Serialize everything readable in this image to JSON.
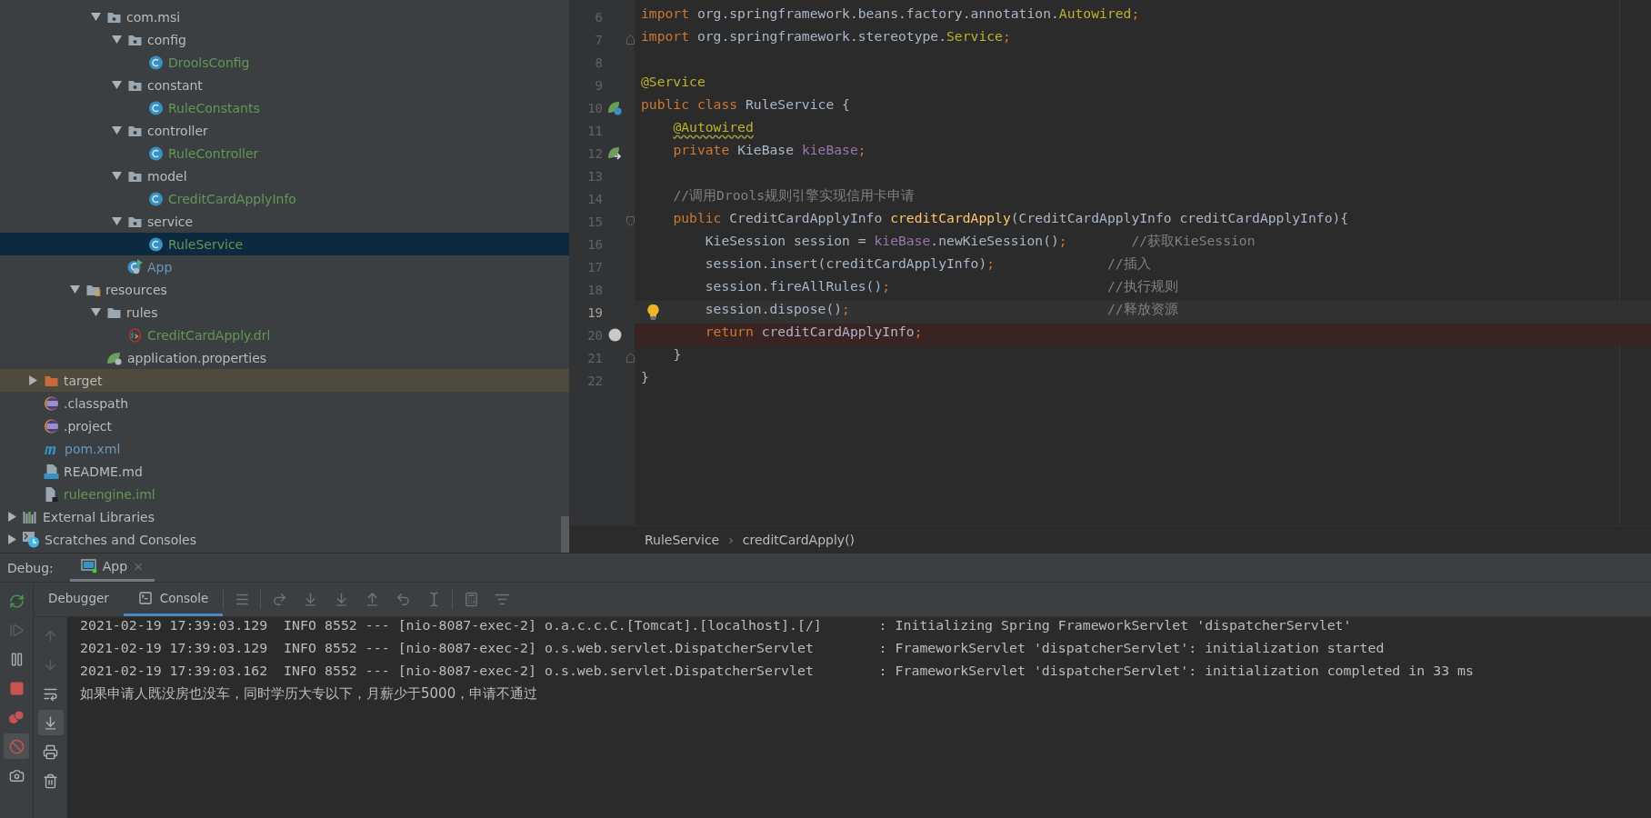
{
  "tree": {
    "packages": [
      {
        "label": "com.msi",
        "kind": "package",
        "color": "#bbbbbb",
        "expanded": true,
        "selected": false,
        "children": [
          {
            "label": "config",
            "kind": "package",
            "color": "#bbbbbb",
            "expanded": true,
            "selected": false,
            "children": [
              {
                "label": "DroolsConfig",
                "kind": "class",
                "color": "#629755",
                "selected": false
              }
            ]
          },
          {
            "label": "constant",
            "kind": "package",
            "color": "#bbbbbb",
            "expanded": true,
            "selected": false,
            "children": [
              {
                "label": "RuleConstants",
                "kind": "class",
                "color": "#629755",
                "selected": false
              }
            ]
          },
          {
            "label": "controller",
            "kind": "package",
            "color": "#bbbbbb",
            "expanded": true,
            "selected": false,
            "children": [
              {
                "label": "RuleController",
                "kind": "class",
                "color": "#629755",
                "selected": false
              }
            ]
          },
          {
            "label": "model",
            "kind": "package",
            "color": "#bbbbbb",
            "expanded": true,
            "selected": false,
            "children": [
              {
                "label": "CreditCardApplyInfo",
                "kind": "class",
                "color": "#629755",
                "selected": false
              }
            ]
          },
          {
            "label": "service",
            "kind": "package",
            "color": "#bbbbbb",
            "expanded": true,
            "selected": false,
            "children": [
              {
                "label": "RuleService",
                "kind": "class",
                "color": "#629755",
                "selected": true
              }
            ]
          },
          {
            "label": "App",
            "kind": "app",
            "color": "#6897bb",
            "selected": false
          }
        ]
      }
    ],
    "main_folders": [
      {
        "label": "resources",
        "kind": "resources",
        "color": "#bbbbbb",
        "expanded": true,
        "selected": false,
        "children": [
          {
            "label": "rules",
            "kind": "folder",
            "color": "#bbbbbb",
            "expanded": true,
            "selected": false,
            "children": [
              {
                "label": "CreditCardApply.drl",
                "kind": "drl",
                "color": "#629755",
                "selected": false
              }
            ]
          },
          {
            "label": "application.properties",
            "kind": "properties",
            "color": "#bbbbbb",
            "selected": false
          }
        ]
      }
    ],
    "module_files": [
      {
        "label": "target",
        "kind": "excluded-folder",
        "color": "#bbbbbb",
        "expanded": false,
        "selected": false
      },
      {
        "label": ".classpath",
        "kind": "eclipse",
        "color": "#bbbbbb",
        "selected": false
      },
      {
        "label": ".project",
        "kind": "eclipse",
        "color": "#bbbbbb",
        "selected": false
      },
      {
        "label": "pom.xml",
        "kind": "maven",
        "color": "#6897bb",
        "selected": false
      },
      {
        "label": "README.md",
        "kind": "markdown",
        "color": "#bbbbbb",
        "selected": false
      },
      {
        "label": "ruleengine.iml",
        "kind": "iml",
        "color": "#629755",
        "selected": false
      }
    ],
    "roots": [
      {
        "label": "External Libraries",
        "kind": "libraries",
        "color": "#bbbbbb",
        "expanded": false,
        "selected": false
      },
      {
        "label": "Scratches and Consoles",
        "kind": "scratches",
        "color": "#bbbbbb",
        "expanded": false,
        "selected": false
      }
    ]
  },
  "editor": {
    "lines": [
      {
        "number": "6",
        "current": false,
        "tokens": [
          {
            "kind": "kw",
            "text": "import "
          },
          {
            "kind": "plain",
            "text": "org.springframework.beans.factory.annotation."
          },
          {
            "kind": "ann",
            "text": "Autowired"
          },
          {
            "kind": "kw",
            "text": ";"
          }
        ]
      },
      {
        "number": "7",
        "current": false,
        "fold": {
          "kind": "end"
        },
        "tokens": [
          {
            "kind": "kw",
            "text": "import "
          },
          {
            "kind": "plain",
            "text": "org.springframework.stereotype."
          },
          {
            "kind": "ann",
            "text": "Service"
          },
          {
            "kind": "kw",
            "text": ";"
          }
        ]
      },
      {
        "number": "8",
        "current": false
      },
      {
        "number": "9",
        "current": false,
        "tokens": [
          {
            "kind": "ann",
            "text": "@Service"
          }
        ]
      },
      {
        "number": "10",
        "current": false,
        "marker": {
          "kind": "bean"
        },
        "tokens": [
          {
            "kind": "kw",
            "text": "public class "
          },
          {
            "kind": "plain",
            "text": "RuleService {"
          }
        ]
      },
      {
        "number": "11",
        "current": false,
        "tokens": [
          {
            "kind": "warn",
            "text": "    @Autowired"
          }
        ]
      },
      {
        "number": "12",
        "current": false,
        "marker": {
          "kind": "bean-injected"
        },
        "tokens": [
          {
            "kind": "kw",
            "text": "    private "
          },
          {
            "kind": "plain",
            "text": "KieBase "
          },
          {
            "kind": "field",
            "text": "kieBase"
          },
          {
            "kind": "kw",
            "text": ";"
          }
        ]
      },
      {
        "number": "13",
        "current": false
      },
      {
        "number": "14",
        "current": false,
        "tokens": [
          {
            "kind": "comment",
            "text": "    //调用Drools规则引擎实现信用卡申请"
          }
        ]
      },
      {
        "number": "15",
        "current": false,
        "fold": {
          "kind": "start"
        },
        "tokens": [
          {
            "kind": "kw",
            "text": "    public "
          },
          {
            "kind": "plain",
            "text": "CreditCardApplyInfo "
          },
          {
            "kind": "fn",
            "text": "creditCardApply"
          },
          {
            "kind": "plain",
            "text": "(CreditCardApplyInfo creditCardApplyInfo){"
          }
        ]
      },
      {
        "number": "16",
        "current": false,
        "tokens": [
          {
            "kind": "plain",
            "text": "        KieSession session = "
          },
          {
            "kind": "field",
            "text": "kieBase"
          },
          {
            "kind": "plain",
            "text": ".newKieSession()"
          },
          {
            "kind": "kw",
            "text": ";"
          },
          {
            "kind": "comment",
            "text": "        //获取KieSession"
          }
        ]
      },
      {
        "number": "17",
        "current": false,
        "tokens": [
          {
            "kind": "plain",
            "text": "        session.insert(creditCardApplyInfo)"
          },
          {
            "kind": "kw",
            "text": ";"
          },
          {
            "kind": "comment",
            "text": "              //插入"
          }
        ]
      },
      {
        "number": "18",
        "current": false,
        "tokens": [
          {
            "kind": "plain",
            "text": "        session.fireAllRules()"
          },
          {
            "kind": "kw",
            "text": ";"
          },
          {
            "kind": "comment",
            "text": "                           //执行规则"
          }
        ]
      },
      {
        "number": "19",
        "current": true,
        "bulb": true,
        "tokens": [
          {
            "kind": "plain",
            "text": "        session.dispose()"
          },
          {
            "kind": "kw",
            "text": ";"
          },
          {
            "kind": "comment",
            "text": "                                //释放资源"
          }
        ]
      },
      {
        "number": "20",
        "current": false,
        "marker": {
          "kind": "breakpoint"
        },
        "tokens": [
          {
            "kind": "kw",
            "text": "        return "
          },
          {
            "kind": "plain",
            "text": "creditCardApplyInfo"
          },
          {
            "kind": "kw",
            "text": ";"
          }
        ]
      },
      {
        "number": "21",
        "current": false,
        "fold": {
          "kind": "end"
        },
        "tokens": [
          {
            "kind": "plain",
            "text": "    }"
          }
        ]
      },
      {
        "number": "22",
        "current": false,
        "tokens": [
          {
            "kind": "plain",
            "text": "}"
          }
        ]
      }
    ],
    "breadcrumb": {
      "items": [
        "RuleService",
        "creditCardApply()"
      ],
      "separator": "›"
    }
  },
  "debug": {
    "title": "Debug:",
    "sessions": [
      {
        "label": "App",
        "close": "×",
        "selected": true
      }
    ],
    "subtabs": [
      {
        "label": "Debugger",
        "selected": false
      },
      {
        "label": "Console",
        "selected": true
      }
    ],
    "toolbar_groups": [
      [
        {
          "kind": "layout"
        }
      ],
      [
        {
          "kind": "step-over"
        },
        {
          "kind": "step-into"
        },
        {
          "kind": "force-step-into"
        },
        {
          "kind": "step-out"
        },
        {
          "kind": "drop-frame"
        },
        {
          "kind": "run-to-cursor"
        }
      ],
      [
        {
          "kind": "evaluate"
        },
        {
          "kind": "trace"
        }
      ]
    ],
    "side_actions": [
      {
        "kind": "rerun",
        "disabled": false,
        "toggled": false
      },
      {
        "kind": "resume",
        "disabled": true,
        "toggled": false
      },
      {
        "kind": "pause",
        "disabled": false,
        "toggled": false
      },
      {
        "kind": "stop",
        "disabled": false,
        "toggled": false
      },
      {
        "kind": "breakpoints",
        "disabled": false,
        "toggled": false
      },
      {
        "kind": "mute",
        "disabled": false,
        "toggled": true
      },
      {
        "kind": "camera",
        "disabled": false,
        "toggled": false
      }
    ],
    "console_actions": [
      {
        "kind": "up",
        "disabled": true,
        "toggled": false
      },
      {
        "kind": "down",
        "disabled": true,
        "toggled": false
      },
      {
        "kind": "wrap",
        "disabled": false,
        "toggled": false
      },
      {
        "kind": "scroll-end",
        "disabled": false,
        "toggled": true
      },
      {
        "kind": "print",
        "disabled": false,
        "toggled": false
      },
      {
        "kind": "clear",
        "disabled": false,
        "toggled": false
      }
    ],
    "console_lines": [
      "2021-02-19 17:39:03.129  INFO 8552 --- [nio-8087-exec-2] o.a.c.c.C.[Tomcat].[localhost].[/]       : Initializing Spring FrameworkServlet 'dispatcherServlet'",
      "2021-02-19 17:39:03.129  INFO 8552 --- [nio-8087-exec-2] o.s.web.servlet.DispatcherServlet        : FrameworkServlet 'dispatcherServlet': initialization started",
      "2021-02-19 17:39:03.162  INFO 8552 --- [nio-8087-exec-2] o.s.web.servlet.DispatcherServlet        : FrameworkServlet 'dispatcherServlet': initialization completed in 33 ms",
      "如果申请人既没房也没车，同时学历大专以下，月薪少于5000，申请不通过"
    ]
  }
}
